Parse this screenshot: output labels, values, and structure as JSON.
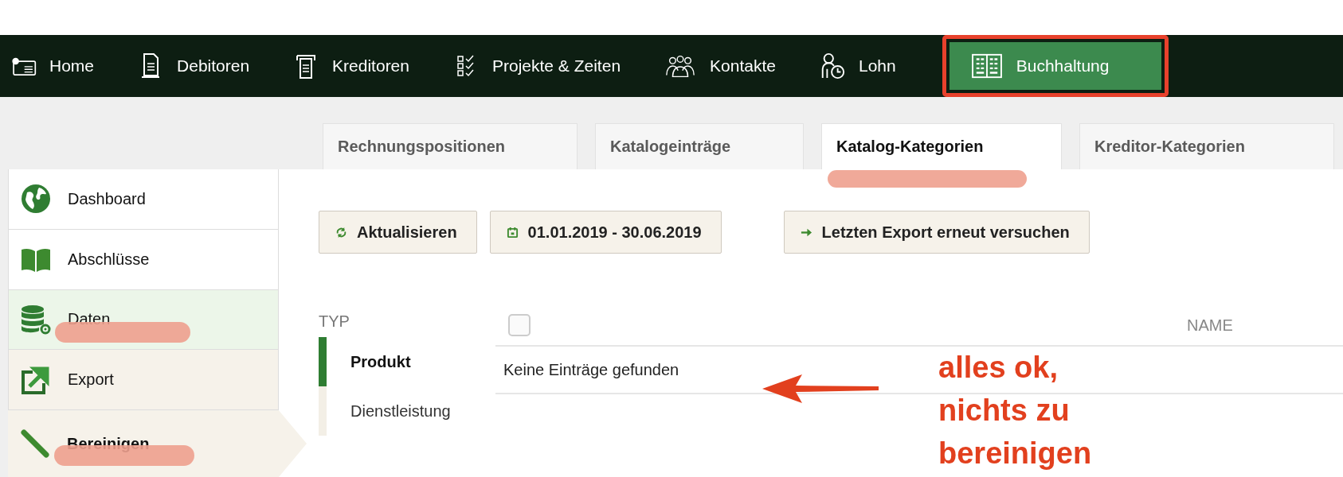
{
  "nav": [
    {
      "label": "Home",
      "selected": false,
      "highlighted": false
    },
    {
      "label": "Debitoren",
      "selected": false,
      "highlighted": false
    },
    {
      "label": "Kreditoren",
      "selected": false,
      "highlighted": false
    },
    {
      "label": "Projekte & Zeiten",
      "selected": false,
      "highlighted": false
    },
    {
      "label": "Kontakte",
      "selected": false,
      "highlighted": false
    },
    {
      "label": "Lohn",
      "selected": false,
      "highlighted": false
    },
    {
      "label": "Buchhaltung",
      "selected": true,
      "highlighted": true
    }
  ],
  "tabs": [
    {
      "label": "Rechnungspositionen",
      "selected": false,
      "highlighted": false
    },
    {
      "label": "Katalogeinträge",
      "selected": false,
      "highlighted": false
    },
    {
      "label": "Katalog-Kategorien",
      "selected": true,
      "highlighted": true
    },
    {
      "label": "Kreditor-Kategorien",
      "selected": false,
      "highlighted": false
    }
  ],
  "sidebar": {
    "items": [
      {
        "label": "Dashboard",
        "selected": false,
        "highlighted": false
      },
      {
        "label": "Abschlüsse",
        "selected": false,
        "highlighted": false
      },
      {
        "label": "Daten",
        "selected": false,
        "highlighted": true,
        "expanded": true,
        "children": [
          {
            "label": "Export",
            "selected": false,
            "highlighted": false
          },
          {
            "label": "Bereinigen",
            "selected": true,
            "highlighted": true
          }
        ]
      }
    ]
  },
  "toolbar": [
    {
      "label": "Aktualisieren"
    },
    {
      "label": "01.01.2019 - 30.06.2019"
    },
    {
      "label": "Letzten Export erneut versuchen"
    }
  ],
  "type_filter": {
    "label": "TYP",
    "options": [
      {
        "label": "Produkt",
        "selected": true
      },
      {
        "label": "Dienstleistung",
        "selected": false
      }
    ]
  },
  "table": {
    "select_all_checked": false,
    "columns": [
      "NAME"
    ],
    "empty_message": "Keine Einträge gefunden"
  },
  "annotation": {
    "lines": [
      "alles ok,",
      "nichts zu",
      "bereinigen"
    ]
  }
}
